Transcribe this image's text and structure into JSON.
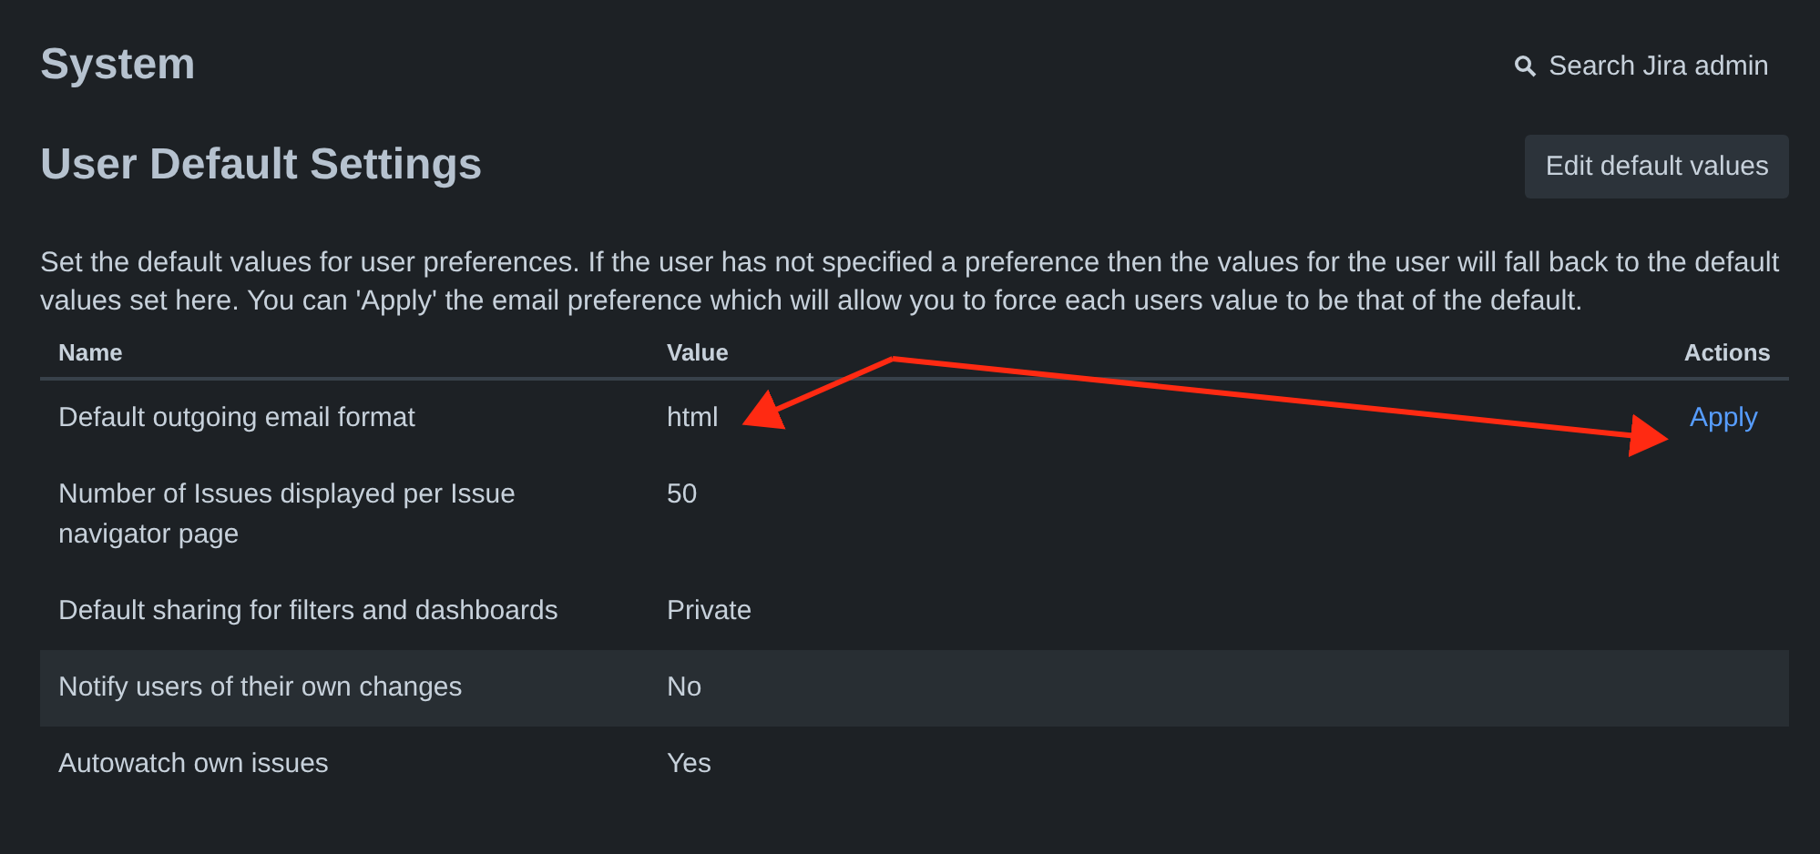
{
  "header": {
    "title": "System",
    "search": "Search Jira admin"
  },
  "section": {
    "title": "User Default Settings",
    "edit_button": "Edit default values",
    "description": "Set the default values for user preferences. If the user has not specified a preference then the values for the user will fall back to the default values set here. You can 'Apply' the email preference which will allow you to force each users value to be that of the default."
  },
  "table": {
    "columns": [
      "Name",
      "Value",
      "Actions"
    ],
    "rows": [
      {
        "name": "Default outgoing email format",
        "value": "html",
        "action": "Apply",
        "highlighted": false
      },
      {
        "name": "Number of Issues displayed per Issue navigator page",
        "value": "50",
        "highlighted": false
      },
      {
        "name": "Default sharing for filters and dashboards",
        "value": "Private",
        "highlighted": false
      },
      {
        "name": "Notify users of their own changes",
        "value": "No",
        "highlighted": true
      },
      {
        "name": "Autowatch own issues",
        "value": "Yes",
        "highlighted": false
      }
    ]
  },
  "annotation": {
    "kind": "arrows",
    "color": "#ff2a12"
  }
}
